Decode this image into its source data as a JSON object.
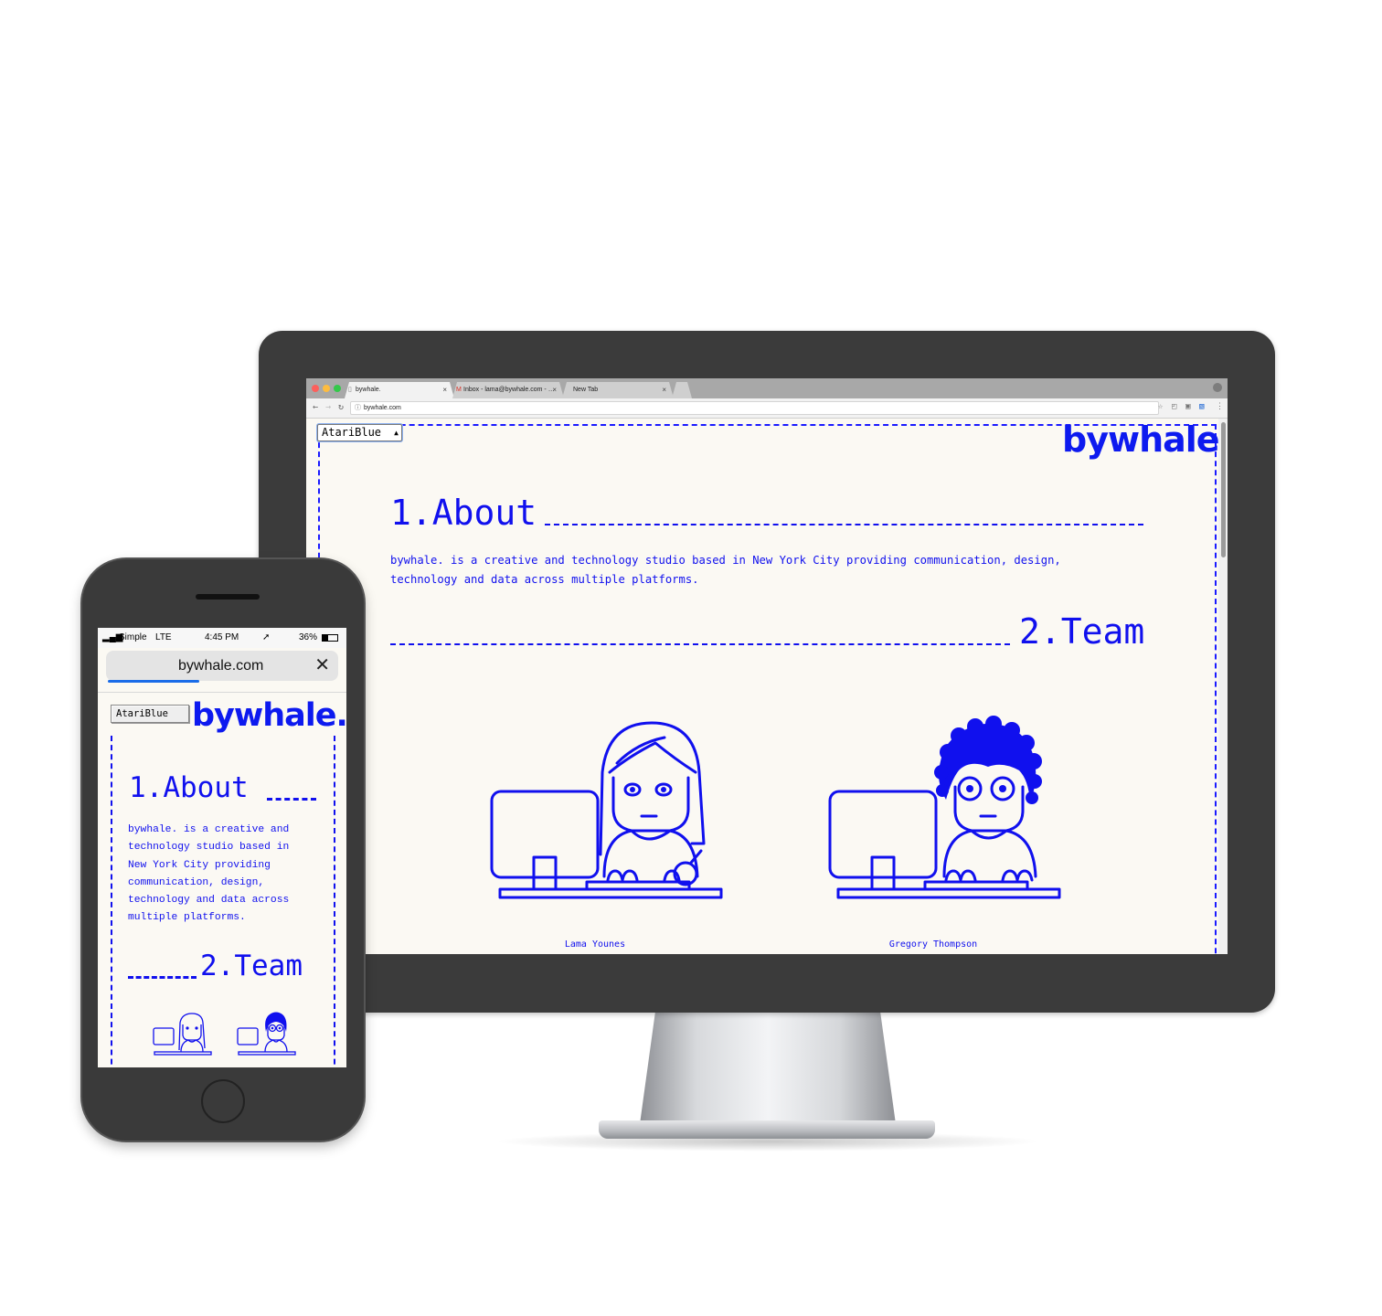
{
  "browser": {
    "tabs": [
      {
        "label": "bywhale."
      },
      {
        "label": "Inbox - lama@bywhale.com - …"
      },
      {
        "label": "New Tab"
      }
    ],
    "tab_close": "×",
    "url": "bywhale.com"
  },
  "site": {
    "theme_select": "AtariBlue",
    "logo": "bywhale.",
    "about_heading": "1.About",
    "about_text": "bywhale. is a creative and technology studio based in New York City providing communication, design, technology and data across multiple platforms.",
    "team_heading": "2.Team",
    "team": [
      {
        "name": "Lama Younes"
      },
      {
        "name": "Gregory Thompson"
      }
    ]
  },
  "phone": {
    "status": {
      "carrier": "Simple",
      "network": "LTE",
      "time": "4:45 PM",
      "battery": "36%"
    },
    "url": "bywhale.com",
    "theme_select": "AtariBlue",
    "logo": "bywhale.",
    "about_heading": "1.About",
    "about_lines": [
      "bywhale. is a creative and",
      "technology studio based in",
      "New York City providing",
      "communication, design,",
      "technology and data across",
      "multiple platforms."
    ],
    "team_heading": "2.Team"
  },
  "colors": {
    "accent": "#1010ee",
    "logo": "#0d1aef",
    "page_background": "#fbf9f3",
    "device": "#3b3b3b"
  }
}
